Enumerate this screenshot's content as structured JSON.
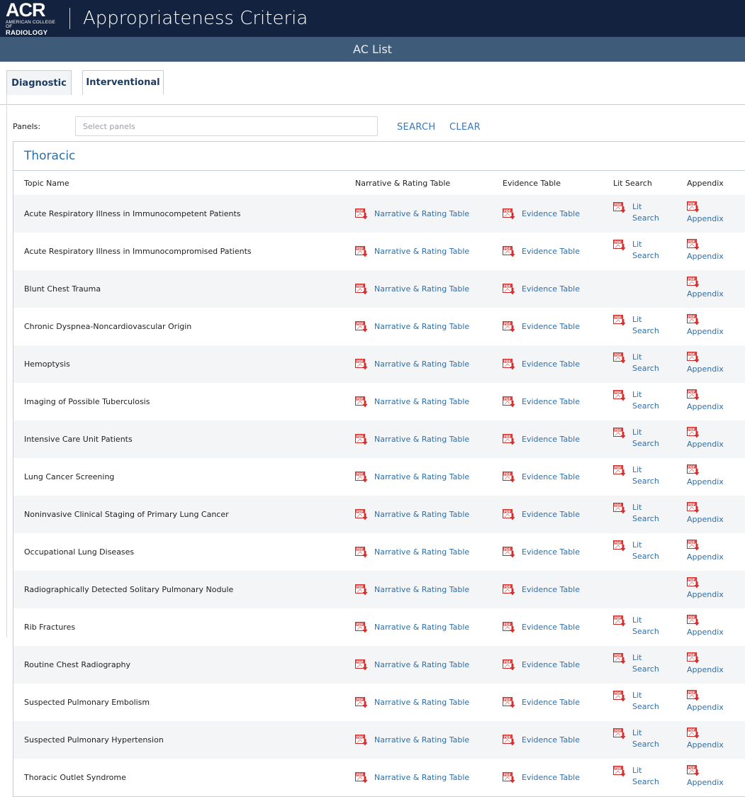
{
  "header": {
    "logo_main": "ACR",
    "logo_sub1": "AMERICAN COLLEGE OF",
    "logo_sub2": "RADIOLOGY",
    "title": "Appropriateness Criteria"
  },
  "subheader": {
    "title": "AC List"
  },
  "tabs": [
    {
      "label": "Diagnostic"
    },
    {
      "label": "Interventional"
    }
  ],
  "filter": {
    "label": "Panels:",
    "placeholder": "Select panels",
    "search_label": "SEARCH",
    "clear_label": "CLEAR"
  },
  "panel": {
    "title": "Thoracic",
    "columns": [
      "Topic Name",
      "Narrative & Rating Table",
      "Evidence Table",
      "Lit Search",
      "Appendix"
    ],
    "link_labels": {
      "narrative": "Narrative & Rating Table",
      "evidence": "Evidence Table",
      "lit1": "Lit",
      "lit2": "Search",
      "appendix": "Appendix"
    },
    "rows": [
      {
        "topic": "Acute Respiratory Illness in Immunocompetent Patients",
        "lit": true
      },
      {
        "topic": "Acute Respiratory Illness in Immunocompromised Patients",
        "lit": true
      },
      {
        "topic": "Blunt Chest Trauma",
        "lit": false
      },
      {
        "topic": "Chronic Dyspnea-Noncardiovascular Origin",
        "lit": true
      },
      {
        "topic": "Hemoptysis",
        "lit": true
      },
      {
        "topic": "Imaging of Possible Tuberculosis",
        "lit": true
      },
      {
        "topic": "Intensive Care Unit Patients",
        "lit": true
      },
      {
        "topic": "Lung Cancer Screening",
        "lit": true
      },
      {
        "topic": "Noninvasive Clinical Staging of Primary Lung Cancer",
        "lit": true
      },
      {
        "topic": "Occupational Lung Diseases",
        "lit": true
      },
      {
        "topic": "Radiographically Detected Solitary Pulmonary Nodule",
        "lit": false
      },
      {
        "topic": "Rib Fractures",
        "lit": true
      },
      {
        "topic": "Routine Chest Radiography",
        "lit": true
      },
      {
        "topic": "Suspected Pulmonary Embolism",
        "lit": true
      },
      {
        "topic": "Suspected Pulmonary Hypertension",
        "lit": true
      },
      {
        "topic": "Thoracic Outlet Syndrome",
        "lit": true
      }
    ]
  },
  "colors": {
    "topbar": "#13223f",
    "subbar": "#3f5b7a",
    "link": "#2f6ea6",
    "pdf_red": "#d32f2f"
  },
  "icons": {
    "pdf": "pdf-download-icon"
  }
}
